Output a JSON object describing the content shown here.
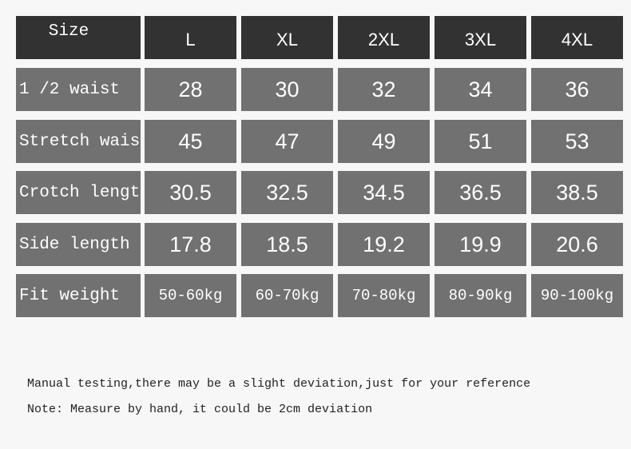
{
  "table": {
    "header": [
      "Size",
      "L",
      "XL",
      "2XL",
      "3XL",
      "4XL"
    ],
    "rows": [
      {
        "label": "1 /2 waist",
        "values": [
          "28",
          "30",
          "32",
          "34",
          "36"
        ]
      },
      {
        "label": "Stretch waist",
        "values": [
          "45",
          "47",
          "49",
          "51",
          "53"
        ]
      },
      {
        "label": "Crotch length",
        "values": [
          "30.5",
          "32.5",
          "34.5",
          "36.5",
          "38.5"
        ]
      },
      {
        "label": "Side length",
        "values": [
          "17.8",
          "18.5",
          "19.2",
          "19.9",
          "20.6"
        ]
      },
      {
        "label": "Fit weight",
        "values": [
          "50-60kg",
          "60-70kg",
          "70-80kg",
          "80-90kg",
          "90-100kg"
        ]
      }
    ]
  },
  "notes": [
    "Manual testing,there may be a slight deviation,just for your reference",
    "Note: Measure by hand, it could be 2cm deviation"
  ],
  "colors": {
    "header": "#323232",
    "body": "#717171",
    "background": "#f7f7f7"
  }
}
